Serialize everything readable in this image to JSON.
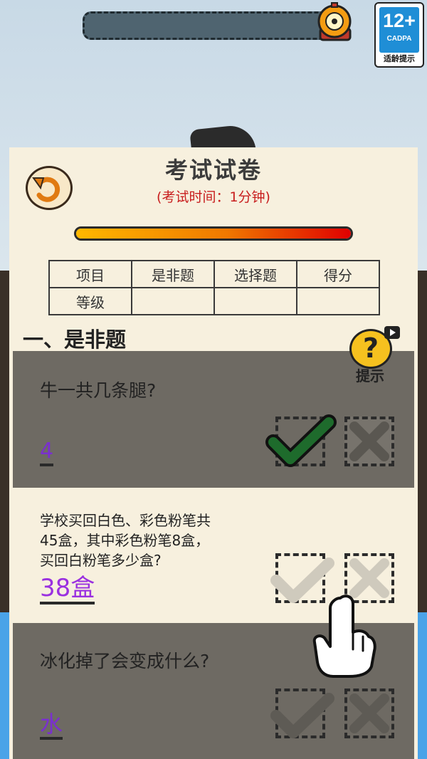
{
  "age_rating": {
    "number": "12+",
    "org": "CADPA",
    "label": "适龄提示"
  },
  "timer": {
    "icon": "alarm-clock-icon"
  },
  "paper": {
    "title": "考试试卷",
    "subtitle": "(考试时间：1分钟)",
    "progress": 1.0,
    "undo_icon": "undo-icon"
  },
  "score_table": {
    "header": [
      "项目",
      "是非题",
      "选择题",
      "得分"
    ],
    "row": [
      "等级",
      "",
      "",
      ""
    ]
  },
  "section_heading": "一、是非题",
  "hint": {
    "label": "提示",
    "icon": "question-mark-icon",
    "video_icon": "video-play-icon"
  },
  "questions": [
    {
      "text": "牛一共几条腿?",
      "answer": "4",
      "state": "correct-checked"
    },
    {
      "text_lines": [
        "学校买回白色、彩色粉笔共",
        "45盒，其中彩色粉笔8盒，",
        "买回白粉笔多少盒?"
      ],
      "answer": "38盒",
      "state": "active"
    },
    {
      "text": "冰化掉了会变成什么?",
      "answer": "水",
      "state": "inactive"
    }
  ],
  "colors": {
    "accent_red": "#c81e1e",
    "answer_purple": "#7a2fd0",
    "check_green": "#1e6b2c"
  }
}
